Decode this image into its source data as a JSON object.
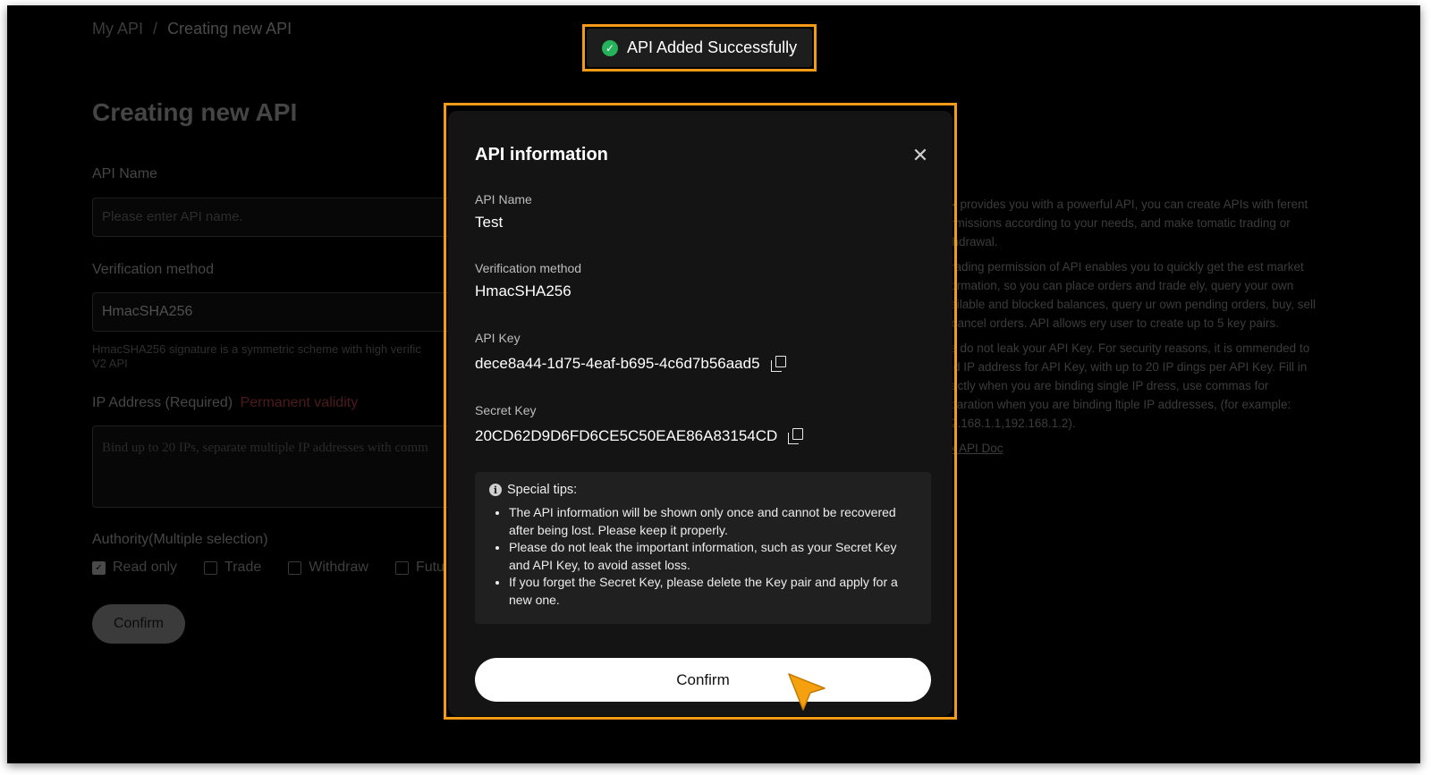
{
  "breadcrumb": {
    "root": "My API",
    "separator": "/",
    "current": "Creating new API"
  },
  "page_title": "Creating new API",
  "form": {
    "api_name_label": "API Name",
    "api_name_placeholder": "Please enter API name.",
    "verification_label": "Verification method",
    "verification_value": "HmacSHA256",
    "verification_hint": "HmacSHA256 signature is a symmetric scheme with high verific",
    "verification_hint_2": "V2 API",
    "ip_label": "IP Address (Required)",
    "ip_permanent": "Permanent validity",
    "ip_placeholder": "Bind up to 20 IPs, separate multiple IP addresses with comm",
    "authority_label": "Authority(Multiple selection)",
    "authority_options": [
      {
        "label": "Read only",
        "checked": true
      },
      {
        "label": "Trade",
        "checked": false
      },
      {
        "label": "Withdraw",
        "checked": false
      },
      {
        "label": "Futu",
        "checked": false
      }
    ],
    "confirm_label": "Confirm"
  },
  "right_info": {
    "p1": "ank provides you with a powerful API, you can create APIs with ferent permissions according to your needs, and make tomatic trading or withdrawal.",
    "p2": "e trading permission of API enables you to quickly get the est market information, so you can place orders and trade ely, query your own available and blocked balances, query ur own pending orders, buy, sell or cancel orders. API allows ery user to create up to 5 key pairs.",
    "p3": "ase do not leak your API Key. For security reasons, it is ommended to bind IP address for API Key, with up to 20 IP dings per API Key. Fill in directly when you are binding single IP dress, use commas for separation when you are binding ltiple IP addresses, (for example: 192.168.1.1,192.168.1.2).",
    "doc_link": "eck API Doc"
  },
  "toast": {
    "text": "API Added Successfully",
    "icon": "check-circle-icon",
    "icon_color": "#25b25a"
  },
  "modal": {
    "title": "API information",
    "api_name_label": "API Name",
    "api_name_value": "Test",
    "verification_label": "Verification method",
    "verification_value": "HmacSHA256",
    "api_key_label": "API Key",
    "api_key_value": "dece8a44-1d75-4eaf-b695-4c6d7b56aad5",
    "secret_key_label": "Secret Key",
    "secret_key_value": "20CD62D9D6FD6CE5C50EAE86A83154CD",
    "tips_title": "Special tips:",
    "tips": [
      "The API information will be shown only once and cannot be recovered after being lost. Please keep it properly.",
      "Please do not leak the important information, such as your Secret Key and API Key, to avoid asset loss.",
      "If you forget the Secret Key, please delete the Key pair and apply for a new one."
    ],
    "confirm_label": "Confirm"
  },
  "colors": {
    "highlight": "#f39a16",
    "background": "#000000",
    "modal_bg": "#141414",
    "accent_success": "#25b25a"
  }
}
